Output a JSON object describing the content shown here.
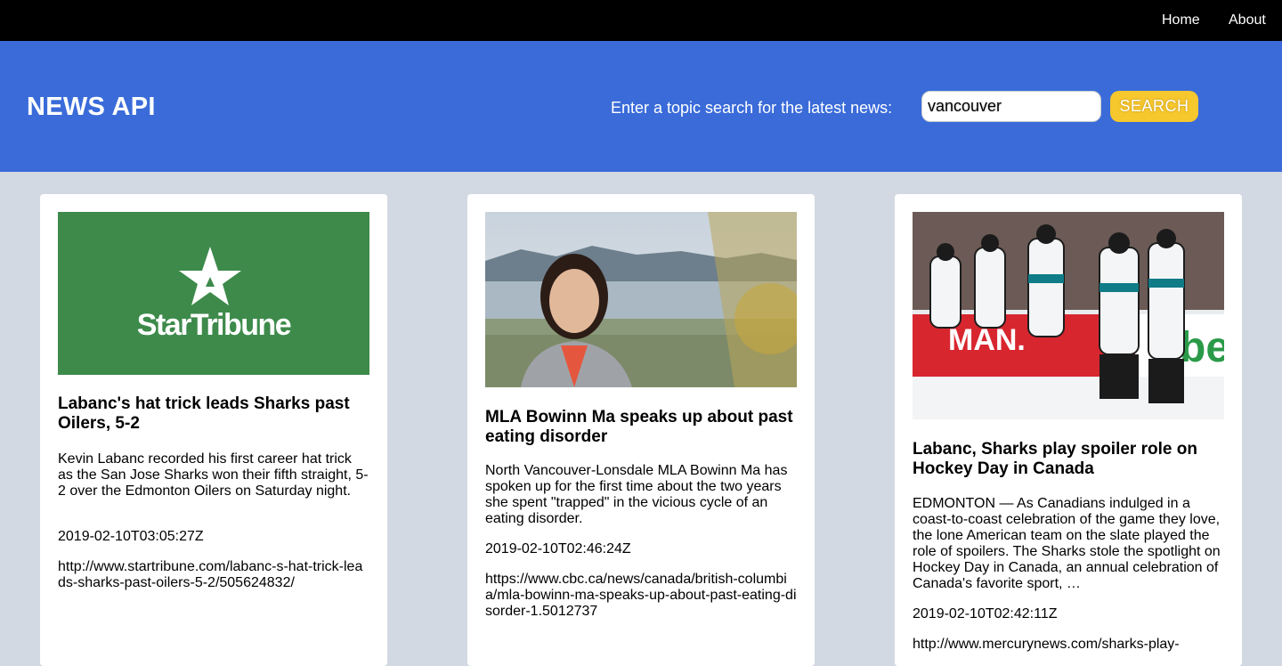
{
  "nav": {
    "home": "Home",
    "about": "About"
  },
  "header": {
    "brand": "NEWS API",
    "search_label": "Enter a topic search for the latest news:",
    "search_value": "vancouver",
    "search_button": "SEARCH"
  },
  "colors": {
    "nav_bg": "#000000",
    "header_bg": "#3a6bd9",
    "page_bg": "#d3d9e2",
    "button_bg": "#f7c72e",
    "logo_green": "#3d8a4b"
  },
  "articles": [
    {
      "image": "startribune-logo-image",
      "logo_text": "StarTribune",
      "title": "Labanc's hat trick leads Sharks past Oilers, 5-2",
      "description": "Kevin Labanc recorded his first career hat trick as the San Jose Sharks won their fifth straight, 5-2 over the Edmonton Oilers on Saturday night.",
      "published": "2019-02-10T03:05:27Z",
      "url": "http://www.startribune.com/labanc-s-hat-trick-leads-sharks-past-oilers-5-2/505624832/"
    },
    {
      "image": "bowinn-ma-portrait-image",
      "title": "MLA Bowinn Ma speaks up about past eating disorder",
      "description": "North Vancouver-Lonsdale MLA Bowinn Ma has spoken up for the first time about the two years she spent \"trapped\" in the vicious cycle of an eating disorder.",
      "published": "2019-02-10T02:46:24Z",
      "url": "https://www.cbc.ca/news/canada/british-columbia/mla-bowinn-ma-speaks-up-about-past-eating-disorder-1.5012737"
    },
    {
      "image": "sharks-celebration-image",
      "title": "Labanc, Sharks play spoiler role on Hockey Day in Canada",
      "description": "EDMONTON — As Canadians indulged in a coast-to-coast celebration of the game they love, the lone American team on the slate played the role of spoilers. The Sharks stole the spotlight on Hockey Day in Canada, an annual celebration of Canada's favorite sport, …",
      "published": "2019-02-10T02:42:11Z",
      "url": "http://www.mercurynews.com/sharks-play-"
    }
  ]
}
